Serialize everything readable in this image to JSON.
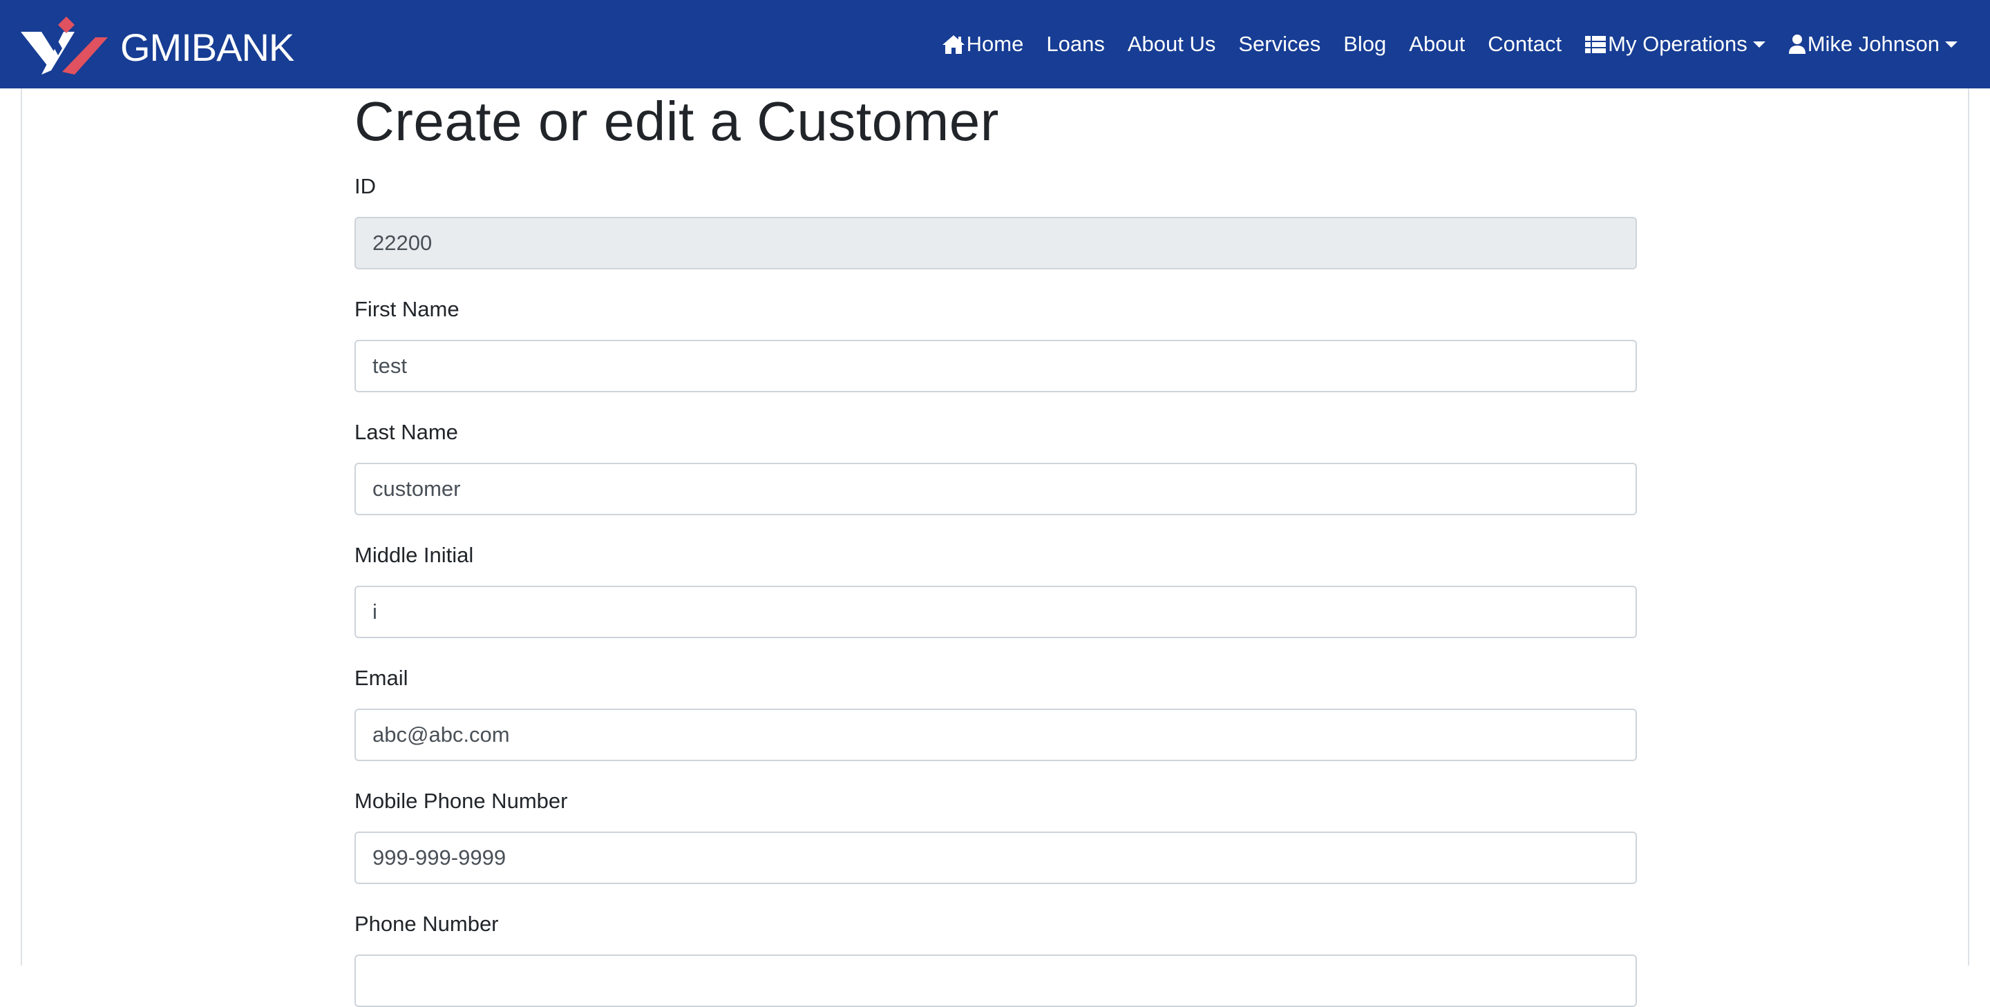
{
  "navbar": {
    "brand": "GMIBANK",
    "items": [
      {
        "label": "Home",
        "icon": "home-icon"
      },
      {
        "label": "Loans"
      },
      {
        "label": "About Us"
      },
      {
        "label": "Services"
      },
      {
        "label": "Blog"
      },
      {
        "label": "About"
      },
      {
        "label": "Contact"
      },
      {
        "label": "My Operations",
        "icon": "list-icon",
        "dropdown": true
      },
      {
        "label": "Mike Johnson",
        "icon": "user-icon",
        "dropdown": true
      }
    ]
  },
  "page": {
    "title": "Create or edit a Customer"
  },
  "form": {
    "id": {
      "label": "ID",
      "value": "22200"
    },
    "first_name": {
      "label": "First Name",
      "value": "test"
    },
    "last_name": {
      "label": "Last Name",
      "value": "customer"
    },
    "middle_initial": {
      "label": "Middle Initial",
      "value": "i"
    },
    "email": {
      "label": "Email",
      "value": "abc@abc.com"
    },
    "mobile_phone": {
      "label": "Mobile Phone Number",
      "value": "999-999-9999"
    },
    "phone": {
      "label": "Phone Number",
      "value": ""
    }
  },
  "colors": {
    "navbar_bg": "#173d94",
    "logo_red": "#e0525f",
    "readonly_bg": "#e9ecef"
  }
}
